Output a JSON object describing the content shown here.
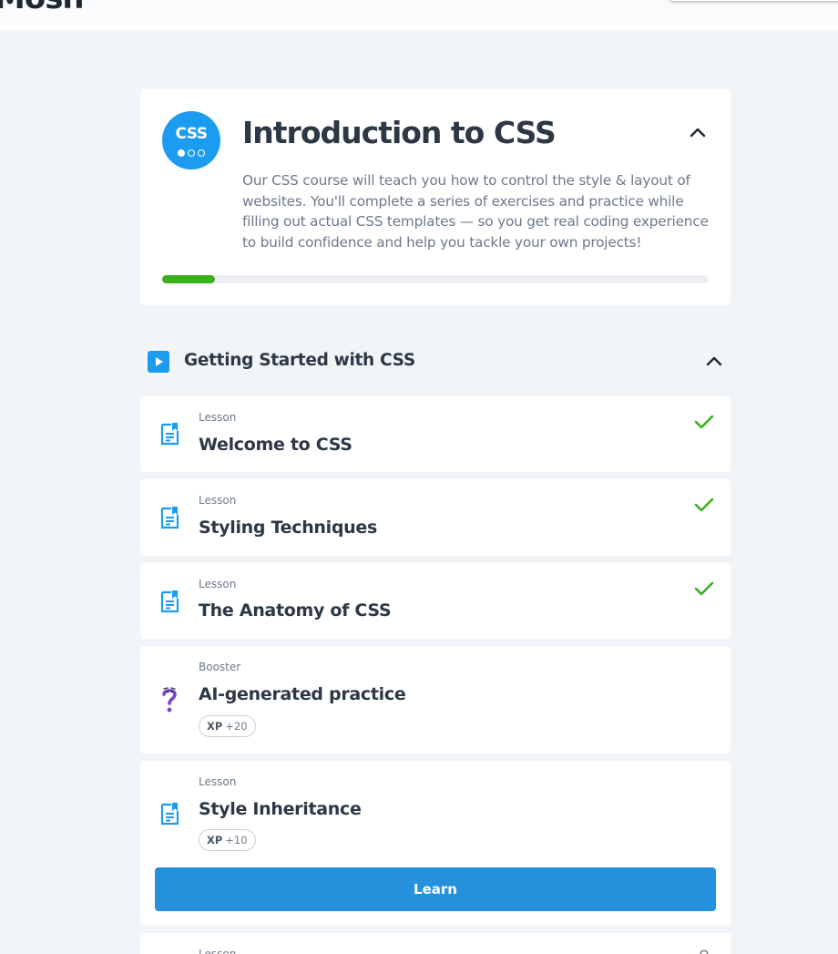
{
  "header": {
    "logo_text": "Mosh"
  },
  "course": {
    "logo_text": "CSS",
    "title": "Introduction to CSS",
    "description": "Our CSS course will teach you how to control the style & layout of websites. You'll complete a series of exercises and practice while filling out actual CSS templates — so you get real coding experience to build confidence and help you tackle your own projects!",
    "progress_fraction": 0.097,
    "progress_color": "#3ab01c",
    "accent_color": "#1c9cf0"
  },
  "section": {
    "title": "Getting Started with CSS",
    "icon": "play-icon"
  },
  "lessons": [
    {
      "type": "Lesson",
      "title": "Welcome to CSS",
      "icon": "document-icon",
      "completed": true
    },
    {
      "type": "Lesson",
      "title": "Styling Techniques",
      "icon": "document-icon",
      "completed": true
    },
    {
      "type": "Lesson",
      "title": "The Anatomy of CSS",
      "icon": "document-icon",
      "completed": true
    },
    {
      "type": "Booster",
      "title": "AI-generated practice",
      "icon": "question-mark-icon",
      "xp_label": "XP",
      "xp_value": "+20",
      "completed": false
    },
    {
      "type": "Lesson",
      "title": "Style Inheritance",
      "icon": "document-icon",
      "xp_label": "XP",
      "xp_value": "+10",
      "completed": false,
      "button_label": "Learn"
    },
    {
      "type": "Lesson",
      "icon": "lock-icon",
      "completed": false
    }
  ]
}
